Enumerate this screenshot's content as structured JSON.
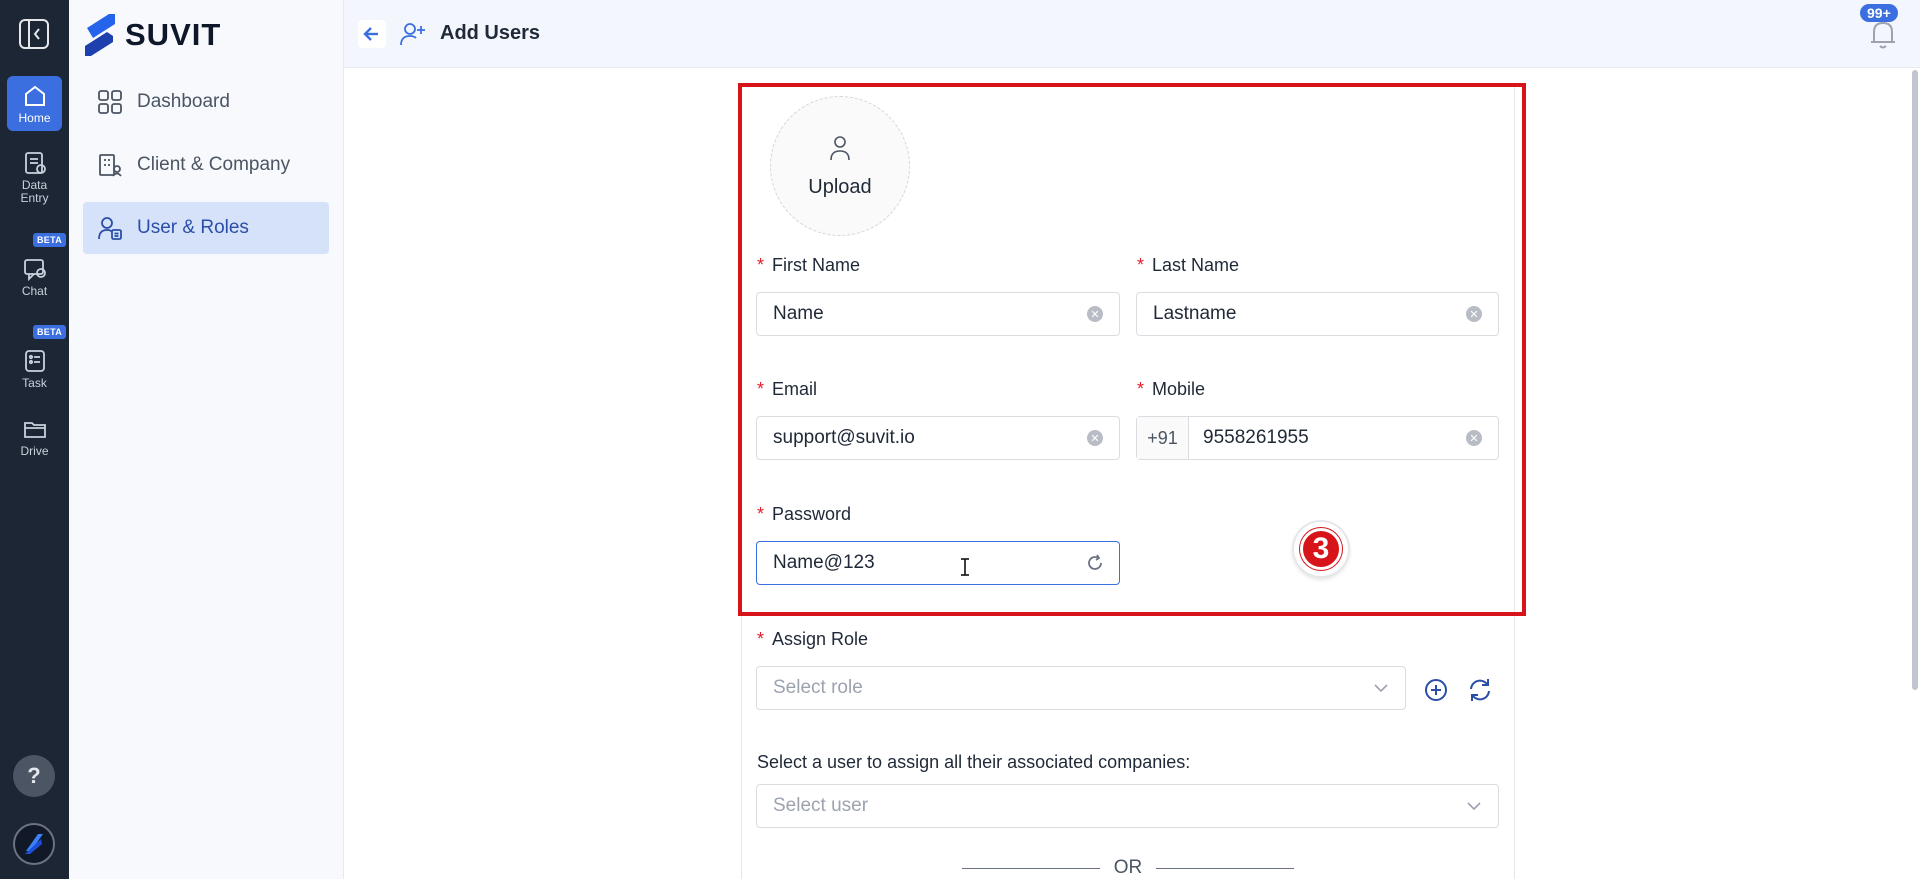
{
  "rail": {
    "items": [
      {
        "label": "Home",
        "icon": "home-icon"
      },
      {
        "label": "Data\nEntry",
        "icon": "data-entry-icon"
      },
      {
        "label": "Chat",
        "icon": "chat-icon",
        "badge": "BETA"
      },
      {
        "label": "Task",
        "icon": "task-icon",
        "badge": "BETA"
      },
      {
        "label": "Drive",
        "icon": "folder-icon"
      }
    ],
    "help_label": "?"
  },
  "sidebar": {
    "brand": "SUVIT",
    "items": [
      {
        "label": "Dashboard",
        "icon": "grid-icon"
      },
      {
        "label": "Client & Company",
        "icon": "building-icon"
      },
      {
        "label": "User & Roles",
        "icon": "user-roles-icon",
        "active": true
      }
    ]
  },
  "header": {
    "title": "Add Users",
    "notifications": "99+"
  },
  "form": {
    "upload_label": "Upload",
    "first_name": {
      "label": "First Name",
      "value": "Name"
    },
    "last_name": {
      "label": "Last Name",
      "value": "Lastname"
    },
    "email": {
      "label": "Email",
      "value": "support@suvit.io"
    },
    "mobile": {
      "label": "Mobile",
      "prefix": "+91",
      "value": "9558261955"
    },
    "password": {
      "label": "Password",
      "value": "Name@123"
    },
    "assign_role": {
      "label": "Assign Role",
      "placeholder": "Select role"
    },
    "assign_user": {
      "label": "Select a user to assign all their associated companies:",
      "placeholder": "Select user"
    },
    "or_text": "OR",
    "required_mark": "*"
  },
  "annotation": {
    "step": "3"
  },
  "colors": {
    "accent": "#3b6fe0",
    "highlight": "#d7141a",
    "rail_bg": "#1d2634"
  }
}
